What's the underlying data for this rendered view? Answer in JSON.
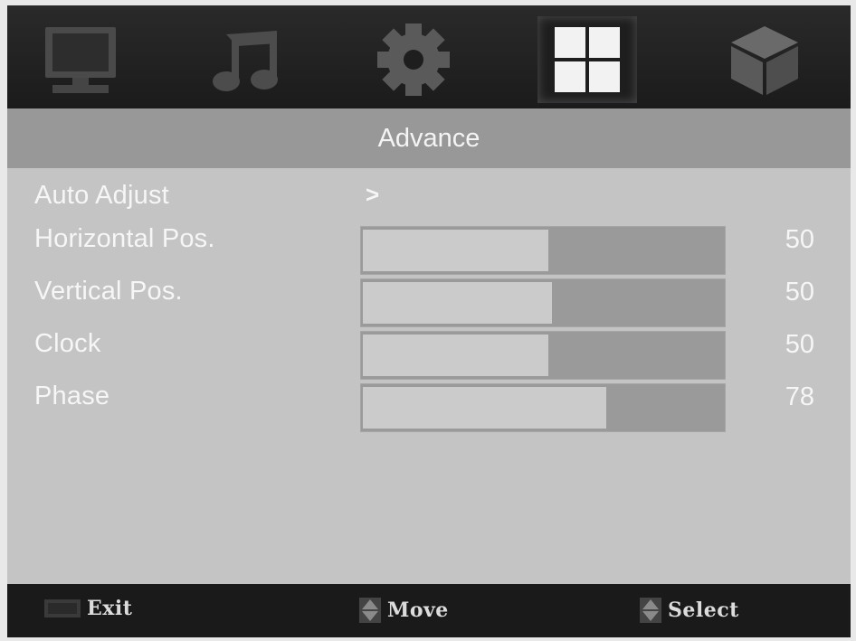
{
  "tabs": [
    {
      "name": "picture",
      "icon": "monitor-icon"
    },
    {
      "name": "sound",
      "icon": "music-note-icon"
    },
    {
      "name": "setup",
      "icon": "gear-icon"
    },
    {
      "name": "advance",
      "icon": "grid-icon",
      "active": true
    },
    {
      "name": "other",
      "icon": "cube-icon"
    }
  ],
  "title": "Advance",
  "menu": {
    "auto_adjust": {
      "label": "Auto Adjust",
      "arrow": ">"
    },
    "horizontal": {
      "label": "Horizontal Pos.",
      "value": "50",
      "level": 0.51
    },
    "vertical": {
      "label": "Vertical Pos.",
      "value": "50",
      "level": 0.52
    },
    "clock": {
      "label": "Clock",
      "value": "50",
      "level": 0.51
    },
    "phase": {
      "label": "Phase",
      "value": "78",
      "level": 0.67
    }
  },
  "hints": {
    "exit": {
      "label": "Exit",
      "key_icon": "menu-key-icon"
    },
    "move": {
      "label": "Move",
      "key_icon": "updown-arrows-icon"
    },
    "select": {
      "label": "Select",
      "key_icon": "updown-arrows-icon"
    }
  },
  "colors": {
    "background": "#c4c4c4",
    "title_bar": "#989898",
    "bar_track": "#9a9a9a",
    "bar_fill": "#cbcbcb"
  }
}
